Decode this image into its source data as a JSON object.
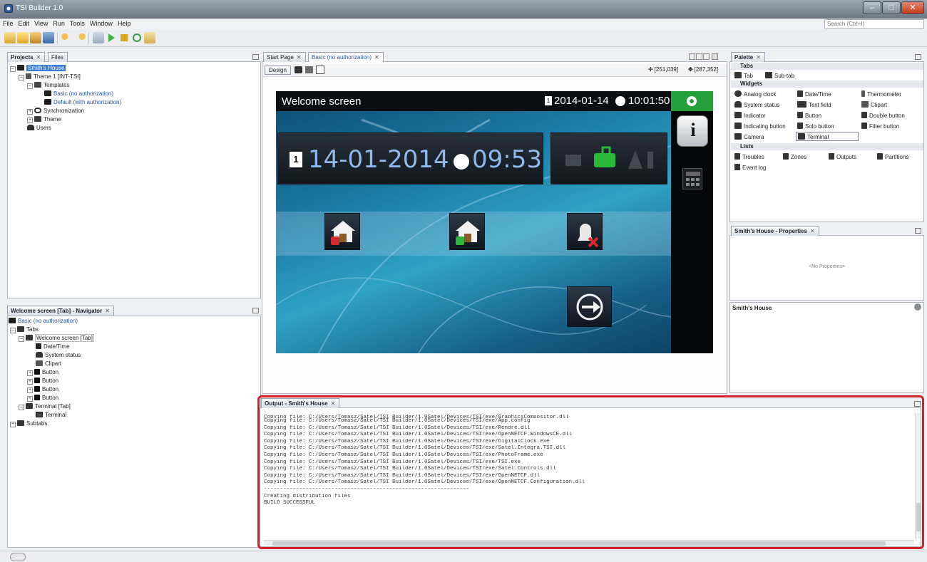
{
  "window": {
    "title": "TSI Builder 1.0"
  },
  "menu": [
    "File",
    "Edit",
    "View",
    "Run",
    "Tools",
    "Window",
    "Help"
  ],
  "search": {
    "placeholder": "Search (Ctrl+I)"
  },
  "projects_panel": {
    "tabs": [
      "Projects",
      "Files"
    ],
    "tree": {
      "root": "Smith's House",
      "theme": "Theme 1 [INT-TSI]",
      "templates": "Templates",
      "template_basic": "Basic (no authorization)",
      "template_default": "Default (with authorization)",
      "synchronization": "Synchronization",
      "theme_node": "Theme",
      "users": "Users"
    }
  },
  "navigator_panel": {
    "title": "Welcome screen [Tab] - Navigator",
    "tree": {
      "root": "Basic (no authorization)",
      "tabs": "Tabs",
      "welcome_tab": "Welcome screen [Tab]",
      "datetime": "Date/Time",
      "system_status": "System status",
      "clipart": "Clipart",
      "button1": "Button",
      "button2": "Button",
      "button3": "Button",
      "button4": "Button",
      "terminal_tab": "Terminal [Tab]",
      "terminal": "Terminal",
      "subtabs": "Subtabs"
    }
  },
  "editor": {
    "tabs": [
      "Start Page",
      "Basic (no authorization)"
    ],
    "design_button": "Design",
    "coords1": "[251,039]",
    "coords2": "[287,352]"
  },
  "screen": {
    "title": "Welcome screen",
    "date": "2014-01-14",
    "time": "10:01:50",
    "big_date": "14-01-2014",
    "big_time": "09:53",
    "calendar_day": "1",
    "info_glyph": "i"
  },
  "palette": {
    "title": "Palette",
    "sections": {
      "tabs": "Tabs",
      "widgets": "Widgets",
      "lists": "Lists"
    },
    "tabs_items": [
      "Tab",
      "Sub-tab"
    ],
    "widgets": [
      [
        "Analog clock",
        "Date/Time",
        "Thermometer"
      ],
      [
        "System status",
        "Text field",
        "Clipart"
      ],
      [
        "Indicator",
        "Button",
        "Double button"
      ],
      [
        "Indicating button",
        "Solo button",
        "Filter button"
      ],
      [
        "Camera",
        "Terminal",
        ""
      ]
    ],
    "lists": [
      [
        "Troubles",
        "Zones",
        "Outputs",
        "Partitions"
      ],
      [
        "Event log"
      ]
    ]
  },
  "properties_panel": {
    "title": "Smith's House - Properties",
    "placeholder": "<No Properties>",
    "selected": "Smith's House"
  },
  "output": {
    "title": "Output - Smith's House",
    "lines": [
      "Copying file: C:/Users/Tomasz/Satel/TSI Builder/1.0Satel/Devices/TSI/exe/GraphicsCompositor.dll",
      "Copying file: C:/Users/Tomasz/Satel/TSI Builder/1.0Satel/Devices/TSI/exe/App.config",
      "Copying file: C:/Users/Tomasz/Satel/TSI Builder/1.0Satel/Devices/TSI/exe/Rendre.dll",
      "Copying file: C:/Users/Tomasz/Satel/TSI Builder/1.0Satel/Devices/TSI/exe/OpenNETCF.WindowsCE.dll",
      "Copying file: C:/Users/Tomasz/Satel/TSI Builder/1.0Satel/Devices/TSI/exe/DigitalClock.exe",
      "Copying file: C:/Users/Tomasz/Satel/TSI Builder/1.0Satel/Devices/TSI/exe/Satel.Integra.TSI.dll",
      "Copying file: C:/Users/Tomasz/Satel/TSI Builder/1.0Satel/Devices/TSI/exe/PhotoFrame.exe",
      "Copying file: C:/Users/Tomasz/Satel/TSI Builder/1.0Satel/Devices/TSI/exe/TSI.exe",
      "Copying file: C:/Users/Tomasz/Satel/TSI Builder/1.0Satel/Devices/TSI/exe/Satel.Controls.dll",
      "Copying file: C:/Users/Tomasz/Satel/TSI Builder/1.0Satel/Devices/TSI/exe/OpenNETCF.dll",
      "Copying file: C:/Users/Tomasz/Satel/TSI Builder/1.0Satel/Devices/TSI/exe/OpenNETCF.Configuration.dll",
      "----------------------------------------------------------------",
      "Creating distribution files",
      "BUILD SUCCESSFUL"
    ]
  },
  "colors": {
    "accent_green": "#25a03a",
    "highlight_red": "#d42027",
    "selection_blue": "#3a7bd5"
  }
}
